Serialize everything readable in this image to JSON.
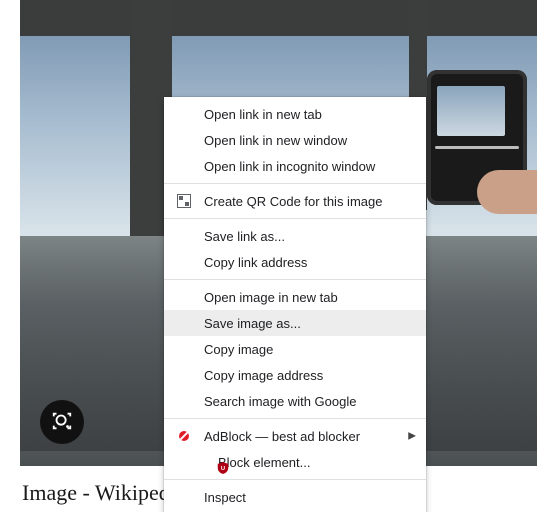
{
  "caption": "Image - Wikipedia",
  "menu": {
    "open_link_new_tab": "Open link in new tab",
    "open_link_new_window": "Open link in new window",
    "open_link_incognito": "Open link in incognito window",
    "create_qr": "Create QR Code for this image",
    "save_link_as": "Save link as...",
    "copy_link_address": "Copy link address",
    "open_image_new_tab": "Open image in new tab",
    "save_image_as": "Save image as...",
    "copy_image": "Copy image",
    "copy_image_address": "Copy image address",
    "search_image_google": "Search image with Google",
    "adblock": "AdBlock — best ad blocker",
    "block_element": "Block element...",
    "inspect": "Inspect"
  }
}
